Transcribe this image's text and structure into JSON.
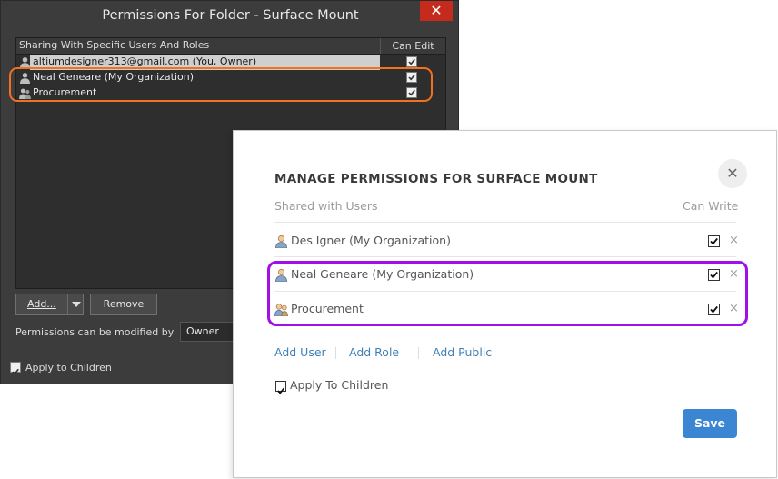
{
  "dark_dialog": {
    "title": "Permissions For Folder - Surface Mount",
    "close_glyph": "✕",
    "list_header": {
      "sharing": "Sharing With Specific Users And Roles",
      "can_edit": "Can Edit"
    },
    "rows": [
      {
        "name": "altiumdesigner313@gmail.com (You, Owner)",
        "icon": "user-icon",
        "can_edit": true
      },
      {
        "name": "Neal Geneare (My Organization)",
        "icon": "user-icon",
        "can_edit": true
      },
      {
        "name": "Procurement",
        "icon": "group-icon",
        "can_edit": true
      }
    ],
    "add_label": "Add...",
    "remove_label": "Remove",
    "permissions_label": "Permissions can be modified by",
    "permissions_value": "Owner",
    "apply_label": "Apply to Children"
  },
  "manage_dialog": {
    "title": "MANAGE PERMISSIONS FOR SURFACE MOUNT",
    "close_glyph": "✕",
    "col_shared": "Shared with Users",
    "col_write": "Can Write",
    "users": [
      {
        "name": "Des Igner (My Organization)",
        "icon": "user-icon",
        "can_write": true
      },
      {
        "name": "Neal Geneare (My Organization)",
        "icon": "user-icon",
        "can_write": true
      },
      {
        "name": "Procurement",
        "icon": "group-icon",
        "can_write": true
      }
    ],
    "remove_glyph": "×",
    "links": {
      "add_user": "Add User",
      "add_role": "Add Role",
      "add_public": "Add Public"
    },
    "apply_label": "Apply To Children",
    "save_label": "Save"
  },
  "colors": {
    "highlight_orange": "#f37021",
    "highlight_purple": "#9f11e6",
    "save_blue": "#3b86d2",
    "link_blue": "#3f80b5",
    "close_red": "#c42b1c"
  }
}
